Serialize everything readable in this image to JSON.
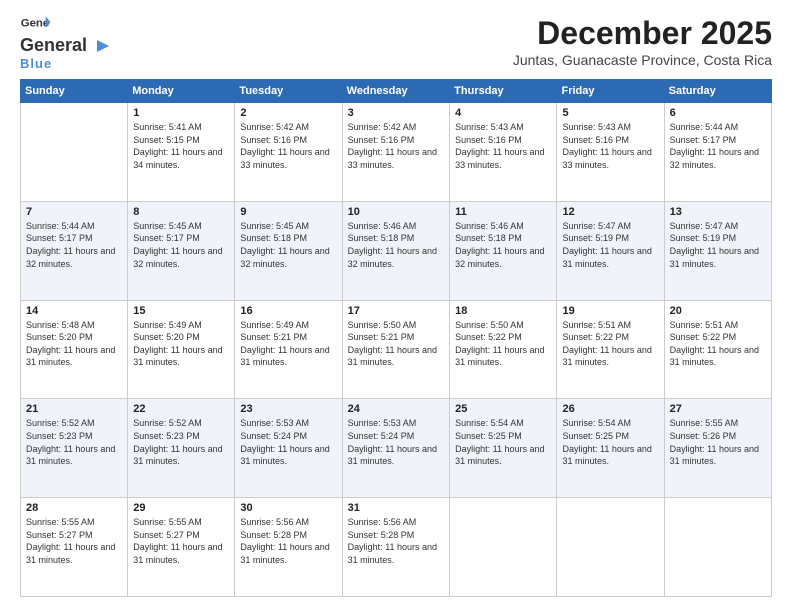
{
  "logo": {
    "general": "General",
    "blue": "Blue"
  },
  "title": "December 2025",
  "location": "Juntas, Guanacaste Province, Costa Rica",
  "header_days": [
    "Sunday",
    "Monday",
    "Tuesday",
    "Wednesday",
    "Thursday",
    "Friday",
    "Saturday"
  ],
  "weeks": [
    [
      {
        "day": "",
        "sunrise": "",
        "sunset": "",
        "daylight": ""
      },
      {
        "day": "1",
        "sunrise": "Sunrise: 5:41 AM",
        "sunset": "Sunset: 5:15 PM",
        "daylight": "Daylight: 11 hours and 34 minutes."
      },
      {
        "day": "2",
        "sunrise": "Sunrise: 5:42 AM",
        "sunset": "Sunset: 5:16 PM",
        "daylight": "Daylight: 11 hours and 33 minutes."
      },
      {
        "day": "3",
        "sunrise": "Sunrise: 5:42 AM",
        "sunset": "Sunset: 5:16 PM",
        "daylight": "Daylight: 11 hours and 33 minutes."
      },
      {
        "day": "4",
        "sunrise": "Sunrise: 5:43 AM",
        "sunset": "Sunset: 5:16 PM",
        "daylight": "Daylight: 11 hours and 33 minutes."
      },
      {
        "day": "5",
        "sunrise": "Sunrise: 5:43 AM",
        "sunset": "Sunset: 5:16 PM",
        "daylight": "Daylight: 11 hours and 33 minutes."
      },
      {
        "day": "6",
        "sunrise": "Sunrise: 5:44 AM",
        "sunset": "Sunset: 5:17 PM",
        "daylight": "Daylight: 11 hours and 32 minutes."
      }
    ],
    [
      {
        "day": "7",
        "sunrise": "Sunrise: 5:44 AM",
        "sunset": "Sunset: 5:17 PM",
        "daylight": "Daylight: 11 hours and 32 minutes."
      },
      {
        "day": "8",
        "sunrise": "Sunrise: 5:45 AM",
        "sunset": "Sunset: 5:17 PM",
        "daylight": "Daylight: 11 hours and 32 minutes."
      },
      {
        "day": "9",
        "sunrise": "Sunrise: 5:45 AM",
        "sunset": "Sunset: 5:18 PM",
        "daylight": "Daylight: 11 hours and 32 minutes."
      },
      {
        "day": "10",
        "sunrise": "Sunrise: 5:46 AM",
        "sunset": "Sunset: 5:18 PM",
        "daylight": "Daylight: 11 hours and 32 minutes."
      },
      {
        "day": "11",
        "sunrise": "Sunrise: 5:46 AM",
        "sunset": "Sunset: 5:18 PM",
        "daylight": "Daylight: 11 hours and 32 minutes."
      },
      {
        "day": "12",
        "sunrise": "Sunrise: 5:47 AM",
        "sunset": "Sunset: 5:19 PM",
        "daylight": "Daylight: 11 hours and 31 minutes."
      },
      {
        "day": "13",
        "sunrise": "Sunrise: 5:47 AM",
        "sunset": "Sunset: 5:19 PM",
        "daylight": "Daylight: 11 hours and 31 minutes."
      }
    ],
    [
      {
        "day": "14",
        "sunrise": "Sunrise: 5:48 AM",
        "sunset": "Sunset: 5:20 PM",
        "daylight": "Daylight: 11 hours and 31 minutes."
      },
      {
        "day": "15",
        "sunrise": "Sunrise: 5:49 AM",
        "sunset": "Sunset: 5:20 PM",
        "daylight": "Daylight: 11 hours and 31 minutes."
      },
      {
        "day": "16",
        "sunrise": "Sunrise: 5:49 AM",
        "sunset": "Sunset: 5:21 PM",
        "daylight": "Daylight: 11 hours and 31 minutes."
      },
      {
        "day": "17",
        "sunrise": "Sunrise: 5:50 AM",
        "sunset": "Sunset: 5:21 PM",
        "daylight": "Daylight: 11 hours and 31 minutes."
      },
      {
        "day": "18",
        "sunrise": "Sunrise: 5:50 AM",
        "sunset": "Sunset: 5:22 PM",
        "daylight": "Daylight: 11 hours and 31 minutes."
      },
      {
        "day": "19",
        "sunrise": "Sunrise: 5:51 AM",
        "sunset": "Sunset: 5:22 PM",
        "daylight": "Daylight: 11 hours and 31 minutes."
      },
      {
        "day": "20",
        "sunrise": "Sunrise: 5:51 AM",
        "sunset": "Sunset: 5:22 PM",
        "daylight": "Daylight: 11 hours and 31 minutes."
      }
    ],
    [
      {
        "day": "21",
        "sunrise": "Sunrise: 5:52 AM",
        "sunset": "Sunset: 5:23 PM",
        "daylight": "Daylight: 11 hours and 31 minutes."
      },
      {
        "day": "22",
        "sunrise": "Sunrise: 5:52 AM",
        "sunset": "Sunset: 5:23 PM",
        "daylight": "Daylight: 11 hours and 31 minutes."
      },
      {
        "day": "23",
        "sunrise": "Sunrise: 5:53 AM",
        "sunset": "Sunset: 5:24 PM",
        "daylight": "Daylight: 11 hours and 31 minutes."
      },
      {
        "day": "24",
        "sunrise": "Sunrise: 5:53 AM",
        "sunset": "Sunset: 5:24 PM",
        "daylight": "Daylight: 11 hours and 31 minutes."
      },
      {
        "day": "25",
        "sunrise": "Sunrise: 5:54 AM",
        "sunset": "Sunset: 5:25 PM",
        "daylight": "Daylight: 11 hours and 31 minutes."
      },
      {
        "day": "26",
        "sunrise": "Sunrise: 5:54 AM",
        "sunset": "Sunset: 5:25 PM",
        "daylight": "Daylight: 11 hours and 31 minutes."
      },
      {
        "day": "27",
        "sunrise": "Sunrise: 5:55 AM",
        "sunset": "Sunset: 5:26 PM",
        "daylight": "Daylight: 11 hours and 31 minutes."
      }
    ],
    [
      {
        "day": "28",
        "sunrise": "Sunrise: 5:55 AM",
        "sunset": "Sunset: 5:27 PM",
        "daylight": "Daylight: 11 hours and 31 minutes."
      },
      {
        "day": "29",
        "sunrise": "Sunrise: 5:55 AM",
        "sunset": "Sunset: 5:27 PM",
        "daylight": "Daylight: 11 hours and 31 minutes."
      },
      {
        "day": "30",
        "sunrise": "Sunrise: 5:56 AM",
        "sunset": "Sunset: 5:28 PM",
        "daylight": "Daylight: 11 hours and 31 minutes."
      },
      {
        "day": "31",
        "sunrise": "Sunrise: 5:56 AM",
        "sunset": "Sunset: 5:28 PM",
        "daylight": "Daylight: 11 hours and 31 minutes."
      },
      {
        "day": "",
        "sunrise": "",
        "sunset": "",
        "daylight": ""
      },
      {
        "day": "",
        "sunrise": "",
        "sunset": "",
        "daylight": ""
      },
      {
        "day": "",
        "sunrise": "",
        "sunset": "",
        "daylight": ""
      }
    ]
  ]
}
